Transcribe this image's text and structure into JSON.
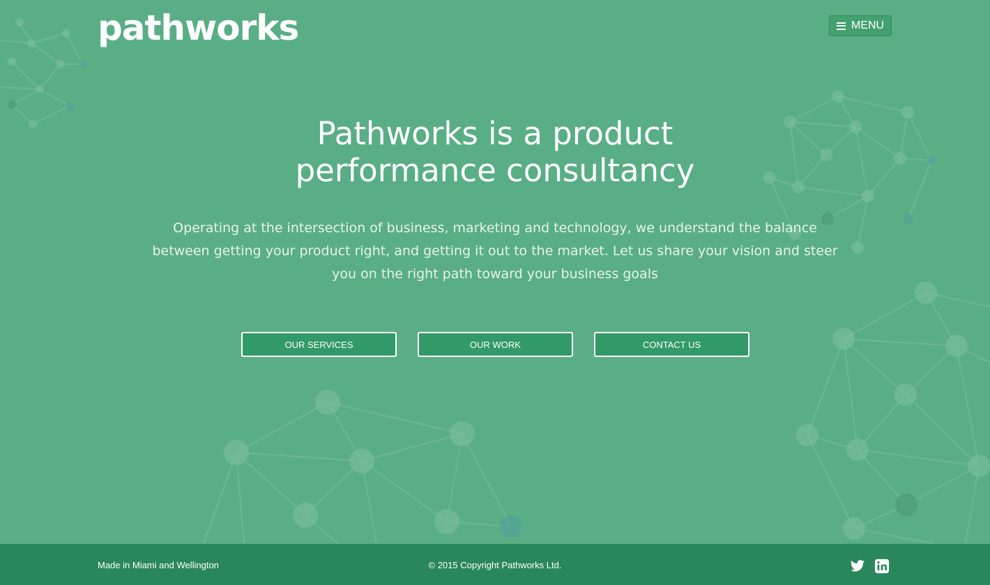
{
  "brand": {
    "logo_text": "pathworks"
  },
  "header": {
    "menu_label": "MENU",
    "menu_icon": "hamburger-icon"
  },
  "hero": {
    "title_lines": [
      "Pathworks is a product",
      "performance consultancy"
    ],
    "description_lines": [
      "Operating at the intersection of business, marketing and technology, we understand the balance",
      "between getting your product right, and getting it out to the market. Let us share your vision and steer",
      "you on the right path toward your business goals"
    ]
  },
  "actions": [
    {
      "label": "OUR SERVICES"
    },
    {
      "label": "OUR WORK"
    },
    {
      "label": "CONTACT US"
    }
  ],
  "footer": {
    "made_in": "Made in Miami and Wellington",
    "copyright": "© 2015 Copyright Pathworks Ltd.",
    "social": [
      {
        "icon": "twitter-icon"
      },
      {
        "icon": "linkedin-icon"
      }
    ]
  },
  "colors": {
    "background": "#5aae85",
    "footer": "#2a875b",
    "button": "#329a68"
  }
}
